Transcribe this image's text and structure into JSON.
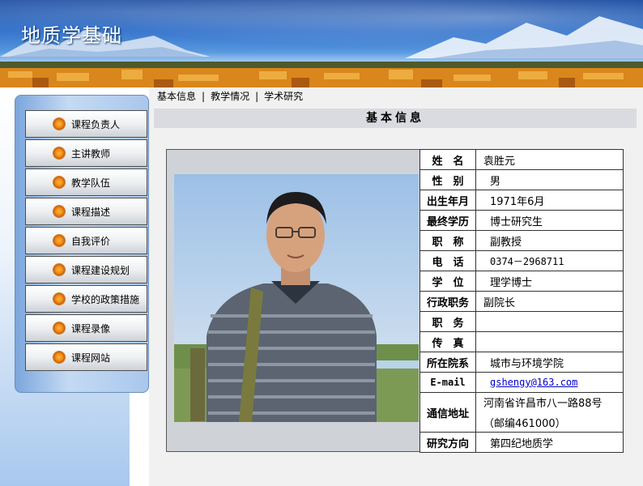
{
  "banner": {
    "title": "地质学基础"
  },
  "menu": [
    {
      "label": "课程负责人"
    },
    {
      "label": "主讲教师"
    },
    {
      "label": "教学队伍"
    },
    {
      "label": "课程描述"
    },
    {
      "label": "自我评价"
    },
    {
      "label": "课程建设规划"
    },
    {
      "label": "学校的政策措施"
    },
    {
      "label": "课程录像"
    },
    {
      "label": "课程网站"
    }
  ],
  "tabs": [
    {
      "label": "基本信息"
    },
    {
      "label": "教学情况"
    },
    {
      "label": "学术研究"
    }
  ],
  "section_title": "基本信息",
  "profile": {
    "rows": [
      {
        "key": "姓　名",
        "value": "袁胜元"
      },
      {
        "key": "性　别",
        "value": "男"
      },
      {
        "key": "出生年月",
        "value": "1971年6月"
      },
      {
        "key": "最终学历",
        "value": "博士研究生"
      },
      {
        "key": "职　称",
        "value": "副教授"
      },
      {
        "key": "电　话",
        "value": "0374－2968711"
      },
      {
        "key": "学　位",
        "value": "理学博士"
      },
      {
        "key": "行政职务",
        "value": "副院长"
      },
      {
        "key": "职　务",
        "value": ""
      },
      {
        "key": "传　真",
        "value": ""
      },
      {
        "key": "所在院系",
        "value": "城市与环境学院"
      },
      {
        "key": "E-mail",
        "value": "gshengy@163.com"
      },
      {
        "key": "通信地址",
        "value_line1": "河南省许昌市八一路88号",
        "value_line2": "（邮编461000）"
      },
      {
        "key": "研究方向",
        "value": "第四纪地质学"
      }
    ]
  },
  "icons": {
    "menu_bullet": "orange-circle-bullet-icon"
  },
  "colors": {
    "banner_blue": "#1d63c6",
    "bullet_orange": "#f28a14",
    "header_bar": "#d9dbe0",
    "link": "#0000cc"
  }
}
